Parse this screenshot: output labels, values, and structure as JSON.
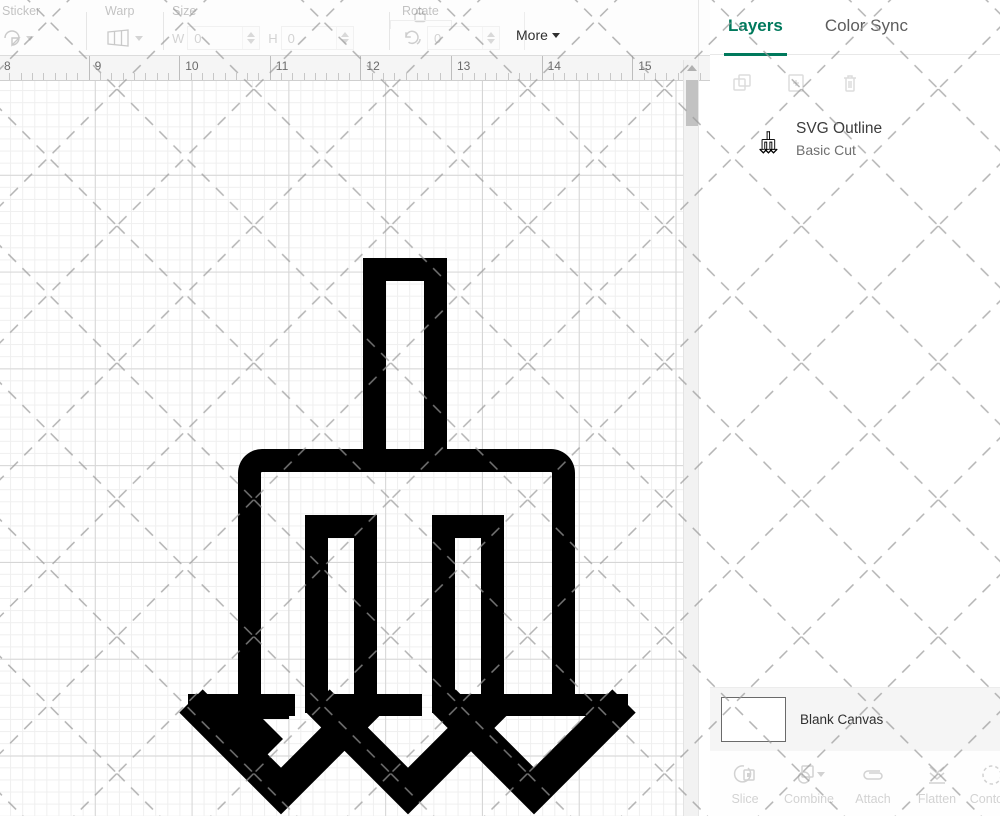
{
  "toolbar": {
    "groups": [
      {
        "label": "Sticker",
        "icon": "sticker-icon",
        "has_caret": true
      },
      {
        "label": "Warp",
        "icon": "warp-icon",
        "has_caret": true
      },
      {
        "label": "Size",
        "icon": "size-icon",
        "has_caret": false
      },
      {
        "label": "Rotate",
        "icon": "rotate-icon",
        "has_caret": false
      }
    ],
    "size": {
      "width_label": "W",
      "width_value": "",
      "width_placeholder": "0",
      "height_label": "H",
      "height_value": "",
      "height_placeholder": "0",
      "lock_icon": "lock-icon"
    },
    "rotate": {
      "value": "",
      "placeholder": "0",
      "icon": "rotate-icon"
    },
    "more_label": "More"
  },
  "ruler": {
    "unit": "in",
    "labels": [
      "8",
      "9",
      "10",
      "11",
      "12",
      "13",
      "14",
      "15"
    ]
  },
  "canvas": {
    "artwork_name": "svg-outline-arrows-artwork",
    "grid": "on",
    "zoom_scrollbar": "vertical"
  },
  "panel": {
    "tabs": [
      {
        "label": "Layers",
        "active": true
      },
      {
        "label": "Color Sync",
        "active": false
      }
    ],
    "accent_color": "#00795c",
    "layer_tools": [
      {
        "name": "duplicate-layer-icon",
        "label": "Duplicate"
      },
      {
        "name": "new-layer-icon",
        "label": "New Layer"
      },
      {
        "name": "delete-layer-icon",
        "label": "Delete"
      }
    ],
    "layers": [
      {
        "title": "SVG Outline",
        "subtitle": "Basic Cut",
        "thumb": "arrows-thumb-icon"
      }
    ],
    "canvas_strip": {
      "label": "Blank Canvas",
      "swatch_color": "#ffffff"
    },
    "actions": [
      {
        "label": "Slice",
        "icon": "slice-icon",
        "has_caret": false
      },
      {
        "label": "Combine",
        "icon": "combine-icon",
        "has_caret": true
      },
      {
        "label": "Attach",
        "icon": "attach-icon",
        "has_caret": false
      },
      {
        "label": "Flatten",
        "icon": "flatten-icon",
        "has_caret": false
      },
      {
        "label": "Contour",
        "icon": "contour-icon",
        "has_caret": false
      }
    ]
  }
}
